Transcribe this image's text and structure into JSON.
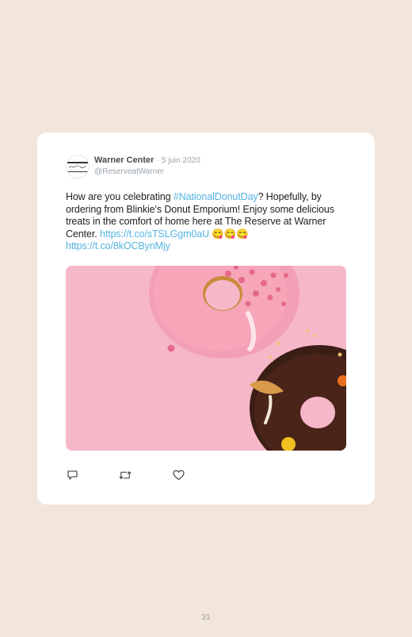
{
  "tweet": {
    "author_name": "Warner Center",
    "separator": "·",
    "date": "5 juin 2020",
    "handle": "@ReserveatWarner",
    "avatar_logo_text": "The Reserve",
    "text_parts": {
      "t1": "How are you celebrating ",
      "hashtag": "#NationalDonutDay",
      "t2": "? Hopefully, by ordering from Blinkie's Donut Emporium! Enjoy some delicious treats in the comfort of home here at The Reserve at Warner Center. ",
      "link1": "https://t.co/sTSLGgm0aU",
      "emojis": " 😋😋😋",
      "link2": "https://t.co/8kOCBynMjy"
    },
    "image_alt": "Pink donut with sprinkles and chocolate donut with candies on pink background",
    "actions": [
      "reply-icon",
      "retweet-icon",
      "like-icon"
    ]
  },
  "page_number": "31",
  "colors": {
    "background": "#f2e6dc",
    "link": "#55b3e0",
    "image_bg": "#f6b7c8"
  }
}
